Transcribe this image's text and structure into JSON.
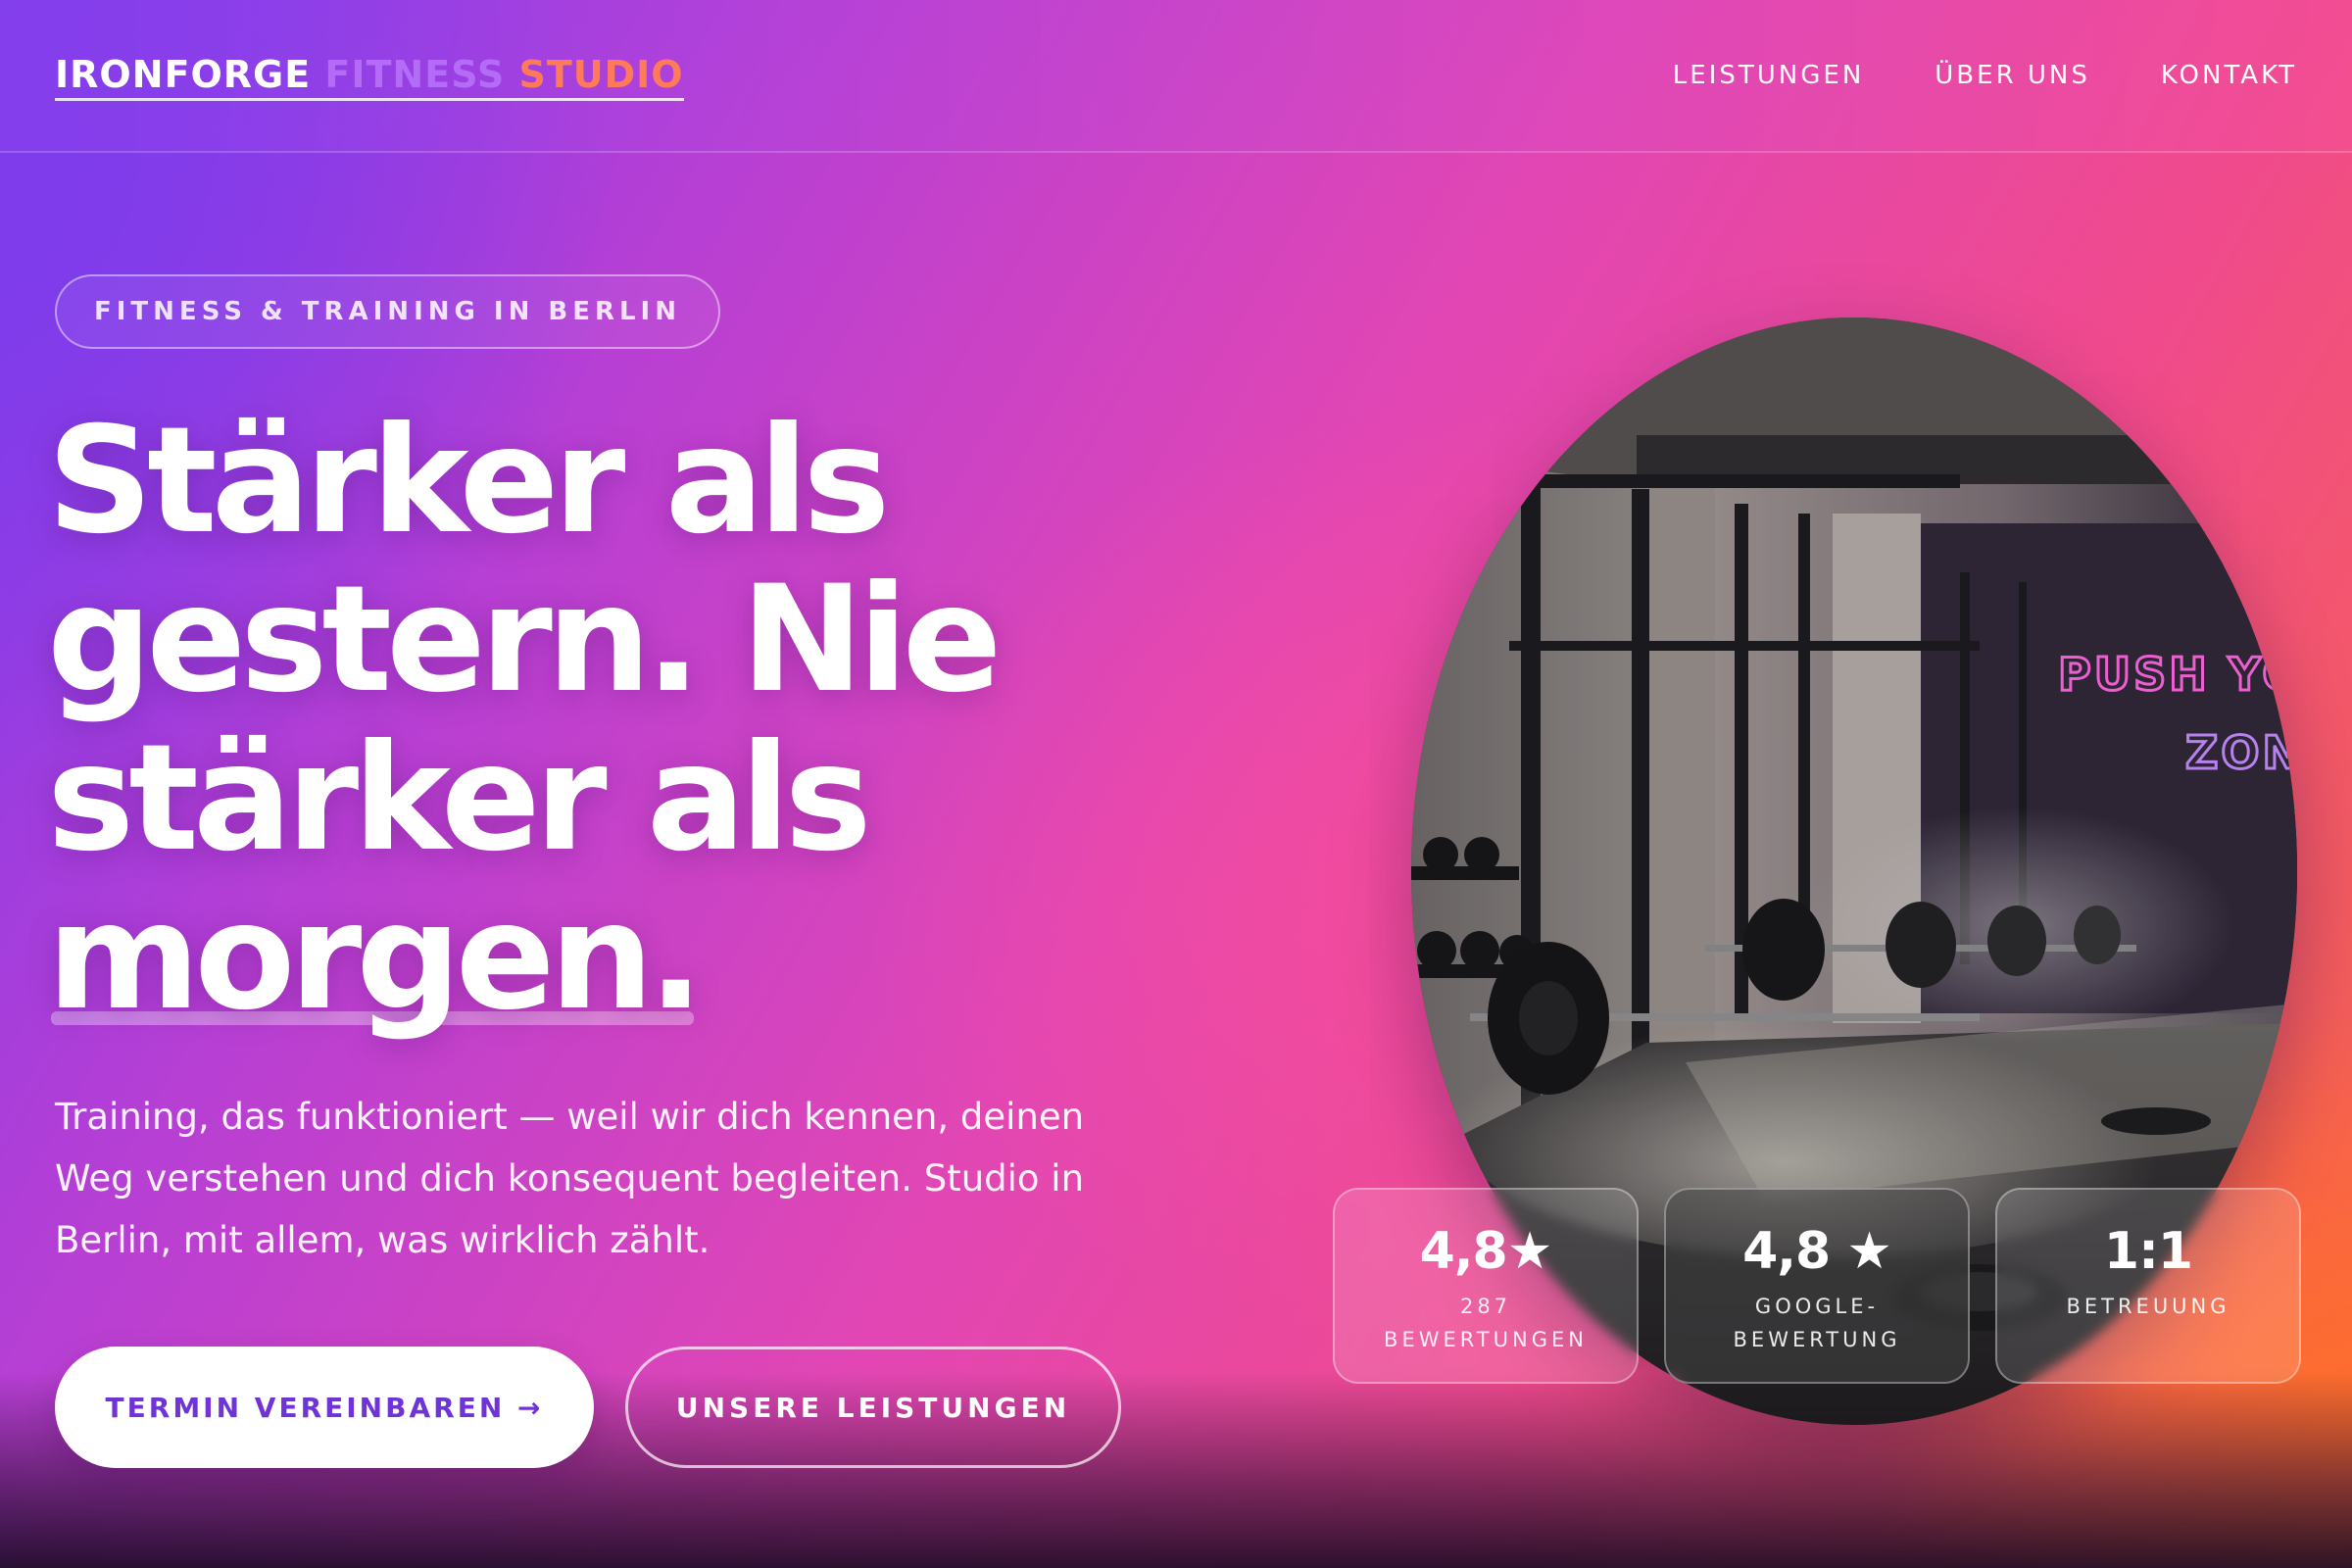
{
  "nav": {
    "logo_part1": "IRONFORGE",
    "logo_part2": " FITNESS",
    "logo_part3": " STUDIO",
    "links": [
      "LEISTUNGEN",
      "ÜBER UNS",
      "KONTAKT"
    ]
  },
  "hero": {
    "badge": "FITNESS & TRAINING IN BERLIN",
    "headline_line1": "Stärker als",
    "headline_line2": "gestern. Nie",
    "headline_line3": "stärker als",
    "headline_line4": "morgen.",
    "lead": "Training, das funktioniert — weil wir dich kennen, deinen Weg verstehen und dich konsequent begleiten. Studio in Berlin, mit allem, was wirklich zählt.",
    "primary_button": "TERMIN VEREINBAREN →",
    "secondary_button": "UNSERE LEISTUNGEN",
    "image_sign_line1": "PUSH YOUR",
    "image_sign_line2": "ZONE"
  },
  "stats": [
    {
      "value": "4,8★",
      "label": "287 BEWERTUNGEN"
    },
    {
      "value": "4,8 ★",
      "label": "GOOGLE-BEWERTUNG"
    },
    {
      "value": "1:1",
      "label": "BETREUUNG"
    }
  ],
  "colors": {
    "gradient_start": "#7c3aed",
    "gradient_mid": "#e146b4",
    "gradient_end": "#f8693f",
    "primary_button_text": "#7033d8",
    "neon_sign": "#ff66e0"
  }
}
